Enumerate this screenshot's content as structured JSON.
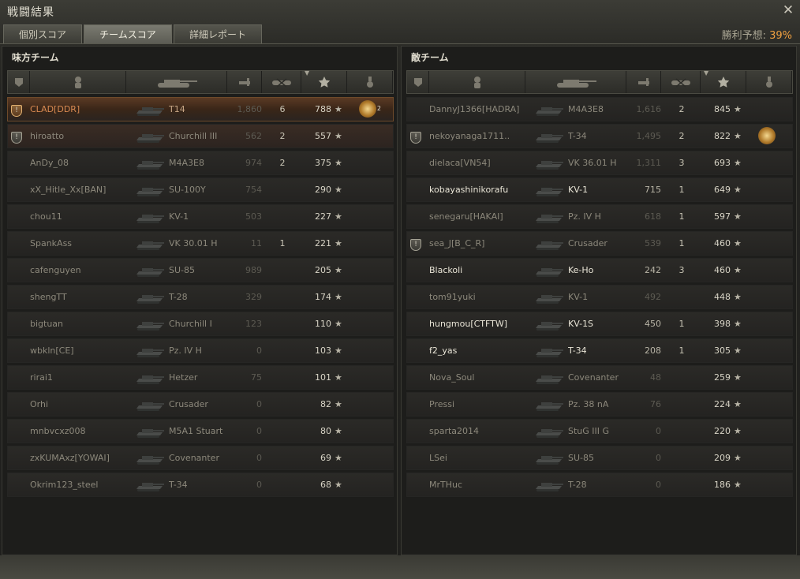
{
  "window": {
    "title": "戦闘結果",
    "close_icon": "close-icon"
  },
  "tabs": [
    {
      "label": "個別スコア",
      "active": false
    },
    {
      "label": "チームスコア",
      "active": true
    },
    {
      "label": "詳細レポート",
      "active": false
    }
  ],
  "win_prediction": {
    "label": "勝利予想:",
    "value": "39%"
  },
  "columns": [
    "badge-icon",
    "player-icon",
    "tank-icon",
    "damage-icon",
    "kills-icon",
    "xp-star-icon",
    "medal-icon"
  ],
  "allies": {
    "title": "味方チーム",
    "rows": [
      {
        "badge": true,
        "name": "CLAD[DDR]",
        "vehicle": "T14",
        "damage": "1,860",
        "kills": "6",
        "xp": "788",
        "medal": true,
        "medal_count": "2",
        "state": "player"
      },
      {
        "badge": true,
        "name": "hiroatto",
        "vehicle": "Churchill III",
        "damage": "562",
        "kills": "2",
        "xp": "557",
        "medal": false,
        "state": "squad"
      },
      {
        "badge": false,
        "name": "AnDy_08",
        "vehicle": "M4A3E8",
        "damage": "974",
        "kills": "2",
        "xp": "375",
        "medal": false,
        "state": "dead"
      },
      {
        "badge": false,
        "name": "xX_Hitle_Xx[BAN]",
        "vehicle": "SU-100Y",
        "damage": "754",
        "kills": "",
        "xp": "290",
        "medal": false,
        "state": "dead"
      },
      {
        "badge": false,
        "name": "chou11",
        "vehicle": "KV-1",
        "damage": "503",
        "kills": "",
        "xp": "227",
        "medal": false,
        "state": "dead"
      },
      {
        "badge": false,
        "name": "SpankAss",
        "vehicle": "VK 30.01 H",
        "damage": "11",
        "kills": "1",
        "xp": "221",
        "medal": false,
        "state": "dead"
      },
      {
        "badge": false,
        "name": "cafenguyen",
        "vehicle": "SU-85",
        "damage": "989",
        "kills": "",
        "xp": "205",
        "medal": false,
        "state": "dead"
      },
      {
        "badge": false,
        "name": "shengTT",
        "vehicle": "T-28",
        "damage": "329",
        "kills": "",
        "xp": "174",
        "medal": false,
        "state": "dead"
      },
      {
        "badge": false,
        "name": "bigtuan",
        "vehicle": "Churchill I",
        "damage": "123",
        "kills": "",
        "xp": "110",
        "medal": false,
        "state": "dead"
      },
      {
        "badge": false,
        "name": "wbkln[CE]",
        "vehicle": "Pz. IV H",
        "damage": "0",
        "kills": "",
        "xp": "103",
        "medal": false,
        "state": "dead"
      },
      {
        "badge": false,
        "name": "rirai1",
        "vehicle": "Hetzer",
        "damage": "75",
        "kills": "",
        "xp": "101",
        "medal": false,
        "state": "dead"
      },
      {
        "badge": false,
        "name": "Orhi",
        "vehicle": "Crusader",
        "damage": "0",
        "kills": "",
        "xp": "82",
        "medal": false,
        "state": "dead"
      },
      {
        "badge": false,
        "name": "mnbvcxz008",
        "vehicle": "M5A1 Stuart",
        "damage": "0",
        "kills": "",
        "xp": "80",
        "medal": false,
        "state": "dead"
      },
      {
        "badge": false,
        "name": "zxKUMAxz[YOWAI]",
        "vehicle": "Covenanter",
        "damage": "0",
        "kills": "",
        "xp": "69",
        "medal": false,
        "state": "dead"
      },
      {
        "badge": false,
        "name": "Okrim123_steel",
        "vehicle": "T-34",
        "damage": "0",
        "kills": "",
        "xp": "68",
        "medal": false,
        "state": "dead"
      }
    ]
  },
  "enemies": {
    "title": "敵チーム",
    "rows": [
      {
        "badge": false,
        "name": "DannyJ1366[HADRA]",
        "vehicle": "M4A3E8",
        "damage": "1,616",
        "kills": "2",
        "xp": "845",
        "medal": false,
        "state": "dead"
      },
      {
        "badge": true,
        "name": "nekoyanaga1711..",
        "vehicle": "T-34",
        "damage": "1,495",
        "kills": "2",
        "xp": "822",
        "medal": true,
        "medal_count": "",
        "state": "dead"
      },
      {
        "badge": false,
        "name": "dielaca[VN54]",
        "vehicle": "VK 36.01 H",
        "damage": "1,311",
        "kills": "3",
        "xp": "693",
        "medal": false,
        "state": "dead"
      },
      {
        "badge": false,
        "name": "kobayashinikorafu",
        "vehicle": "KV-1",
        "damage": "715",
        "kills": "1",
        "xp": "649",
        "medal": false,
        "state": "alive"
      },
      {
        "badge": false,
        "name": "senegaru[HAKAI]",
        "vehicle": "Pz. IV H",
        "damage": "618",
        "kills": "1",
        "xp": "597",
        "medal": false,
        "state": "dead"
      },
      {
        "badge": true,
        "name": "sea_J[B_C_R]",
        "vehicle": "Crusader",
        "damage": "539",
        "kills": "1",
        "xp": "460",
        "medal": false,
        "state": "dead"
      },
      {
        "badge": false,
        "name": "Blackoli",
        "vehicle": "Ke-Ho",
        "damage": "242",
        "kills": "3",
        "xp": "460",
        "medal": false,
        "state": "alive"
      },
      {
        "badge": false,
        "name": "tom91yuki",
        "vehicle": "KV-1",
        "damage": "492",
        "kills": "",
        "xp": "448",
        "medal": false,
        "state": "dead"
      },
      {
        "badge": false,
        "name": "hungmou[CTFTW]",
        "vehicle": "KV-1S",
        "damage": "450",
        "kills": "1",
        "xp": "398",
        "medal": false,
        "state": "alive"
      },
      {
        "badge": false,
        "name": "f2_yas",
        "vehicle": "T-34",
        "damage": "208",
        "kills": "1",
        "xp": "305",
        "medal": false,
        "state": "alive"
      },
      {
        "badge": false,
        "name": "Nova_Soul",
        "vehicle": "Covenanter",
        "damage": "48",
        "kills": "",
        "xp": "259",
        "medal": false,
        "state": "dead"
      },
      {
        "badge": false,
        "name": "Pressi",
        "vehicle": "Pz. 38 nA",
        "damage": "76",
        "kills": "",
        "xp": "224",
        "medal": false,
        "state": "dead"
      },
      {
        "badge": false,
        "name": "sparta2014",
        "vehicle": "StuG III G",
        "damage": "0",
        "kills": "",
        "xp": "220",
        "medal": false,
        "state": "dead"
      },
      {
        "badge": false,
        "name": "LSei",
        "vehicle": "SU-85",
        "damage": "0",
        "kills": "",
        "xp": "209",
        "medal": false,
        "state": "dead"
      },
      {
        "badge": false,
        "name": "MrTHuc",
        "vehicle": "T-28",
        "damage": "0",
        "kills": "",
        "xp": "186",
        "medal": false,
        "state": "dead"
      }
    ]
  }
}
